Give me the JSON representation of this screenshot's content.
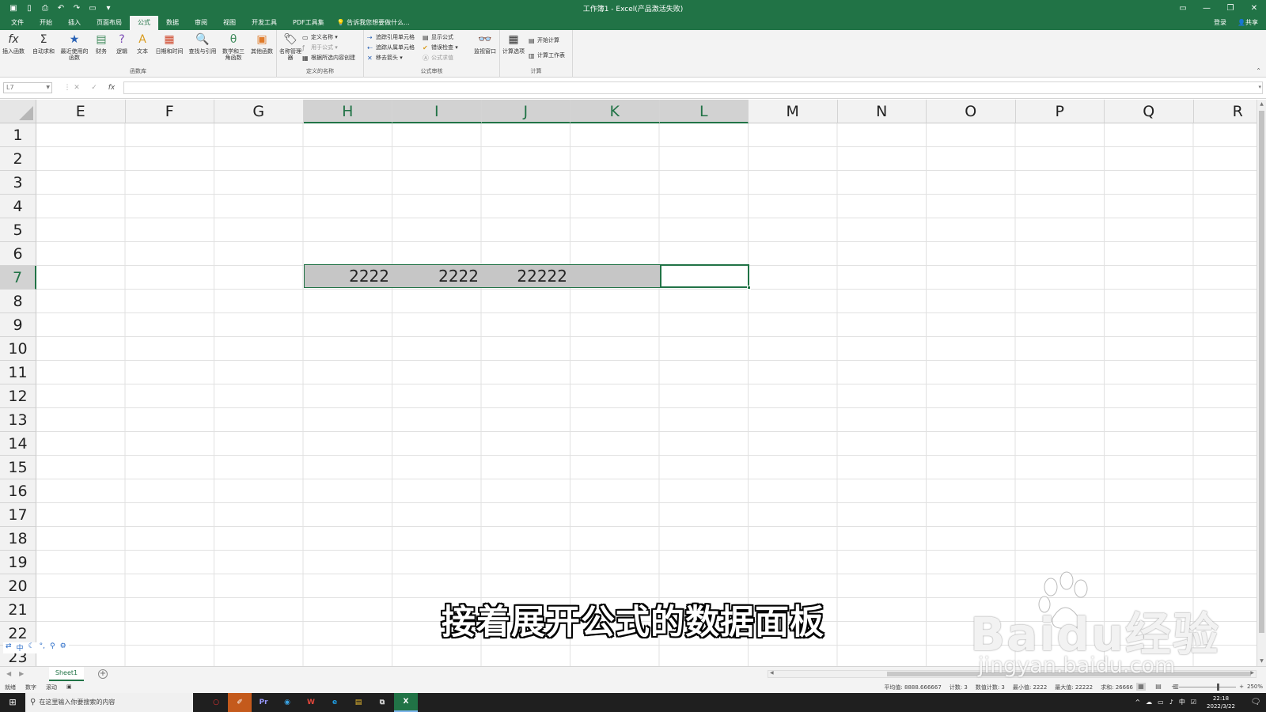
{
  "window": {
    "title": "工作簿1 - Excel(产品激活失败)",
    "qat_icons": [
      "save-icon",
      "new-icon",
      "print-preview-icon",
      "undo-icon",
      "redo-icon",
      "open-icon",
      "customize-icon"
    ]
  },
  "tabs": [
    "文件",
    "开始",
    "插入",
    "页面布局",
    "公式",
    "数据",
    "审阅",
    "视图",
    "开发工具",
    "PDF工具集"
  ],
  "active_tab": "公式",
  "tell_me": "告诉我您想要做什么...",
  "account": {
    "login": "登录",
    "share": "共享"
  },
  "ribbon": {
    "function_library": {
      "label": "函数库",
      "buttons": [
        "插入函数",
        "自动求和",
        "最近使用的函数",
        "财务",
        "逻辑",
        "文本",
        "日期和时间",
        "查找与引用",
        "数学和三角函数",
        "其他函数"
      ]
    },
    "defined_names": {
      "label": "定义的名称",
      "name_manager": "名称管理器",
      "define_name": "定义名称",
      "use_in_formula": "用于公式",
      "create_from_selection": "根据所选内容创建"
    },
    "formula_auditing": {
      "label": "公式审核",
      "trace_precedents": "追踪引用单元格",
      "trace_dependents": "追踪从属单元格",
      "remove_arrows": "移去箭头",
      "show_formulas": "显示公式",
      "error_checking": "错误检查",
      "evaluate_formula": "公式求值",
      "watch_window": "监视窗口"
    },
    "calculation": {
      "label": "计算",
      "calc_options": "计算选项",
      "calc_now": "开始计算",
      "calc_sheet": "计算工作表"
    }
  },
  "formula_bar": {
    "name_box": "L7",
    "value": ""
  },
  "grid": {
    "columns": [
      "E",
      "F",
      "G",
      "H",
      "I",
      "J",
      "K",
      "L",
      "M",
      "N",
      "O",
      "P",
      "Q",
      "R"
    ],
    "selected_columns": [
      "H",
      "I",
      "J",
      "K",
      "L"
    ],
    "rows": [
      "1",
      "2",
      "3",
      "4",
      "5",
      "6",
      "7",
      "8",
      "9",
      "10",
      "11",
      "12",
      "13",
      "14",
      "15",
      "16",
      "17",
      "18",
      "19",
      "20",
      "21",
      "22",
      "23"
    ],
    "selected_row": "7",
    "cells": [
      {
        "ref": "H7",
        "value": "2222"
      },
      {
        "ref": "I7",
        "value": "2222"
      },
      {
        "ref": "J7",
        "value": "22222"
      }
    ]
  },
  "ime_toolbar": [
    "中",
    "☾",
    "°,",
    "⚲",
    "⚙"
  ],
  "sheets": [
    "Sheet1"
  ],
  "status": {
    "ready": "就绪",
    "num": "数字",
    "scroll": "滚动",
    "average": "平均值: 8888.666667",
    "count": "计数: 3",
    "numeric_count": "数值计数: 3",
    "min": "最小值: 2222",
    "max": "最大值: 22222",
    "sum": "求和: 26666",
    "zoom": "250%"
  },
  "taskbar": {
    "search_placeholder": "在这里输入你要搜索的内容",
    "apps": [
      "○",
      "✐",
      "Pr",
      "◉",
      "W",
      "e",
      "▤",
      "⧉",
      "X"
    ],
    "tray": [
      "^",
      "☁",
      "▭",
      "♪",
      "中",
      "☑"
    ],
    "time": "22:18",
    "date": "2022/3/22"
  },
  "overlay": {
    "subtitle": "接着展开公式的数据面板",
    "watermark_logo": "Baidu经验",
    "watermark_url": "jingyan.baidu.com"
  }
}
